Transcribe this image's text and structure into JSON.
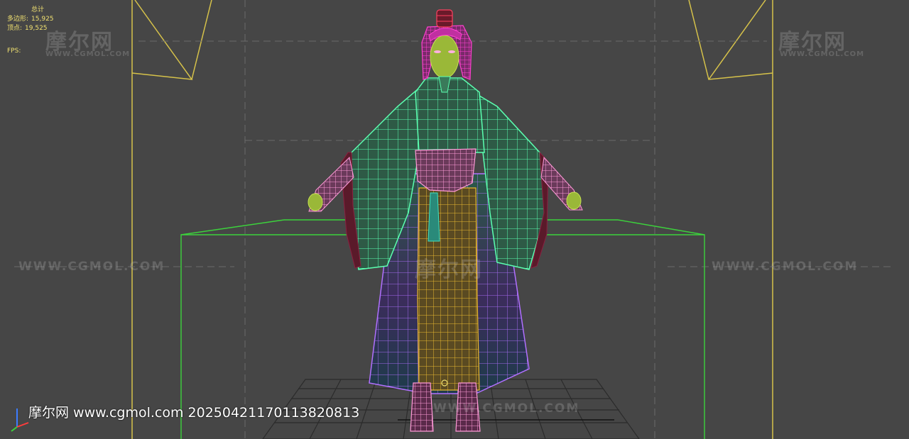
{
  "stats": {
    "header": "总计",
    "polygons_label": "多边形:",
    "polygons_value": "15,925",
    "vertices_label": "顶点:",
    "vertices_value": "19,525",
    "fps_label": "FPS:"
  },
  "watermark": {
    "logo_text": "摩尔网",
    "logo_sub": "WWW.CGMOL.COM",
    "url_text": "WWW.CGMOL.COM"
  },
  "credit": {
    "text": "摩尔网 www.cgmol.com 20250421170113820813"
  },
  "colors": {
    "background": "#464646",
    "safe_frame": "#d6c24a",
    "bounding_box": "#3cd23c",
    "grid": "#2a2a2a",
    "cloth_upper": "#5bffb0",
    "cloth_lower": "#b070ff",
    "skirt": "#f0c040",
    "sash": "#ff9ad8",
    "hair": "#ff40d0",
    "skin": "#9ab838"
  }
}
